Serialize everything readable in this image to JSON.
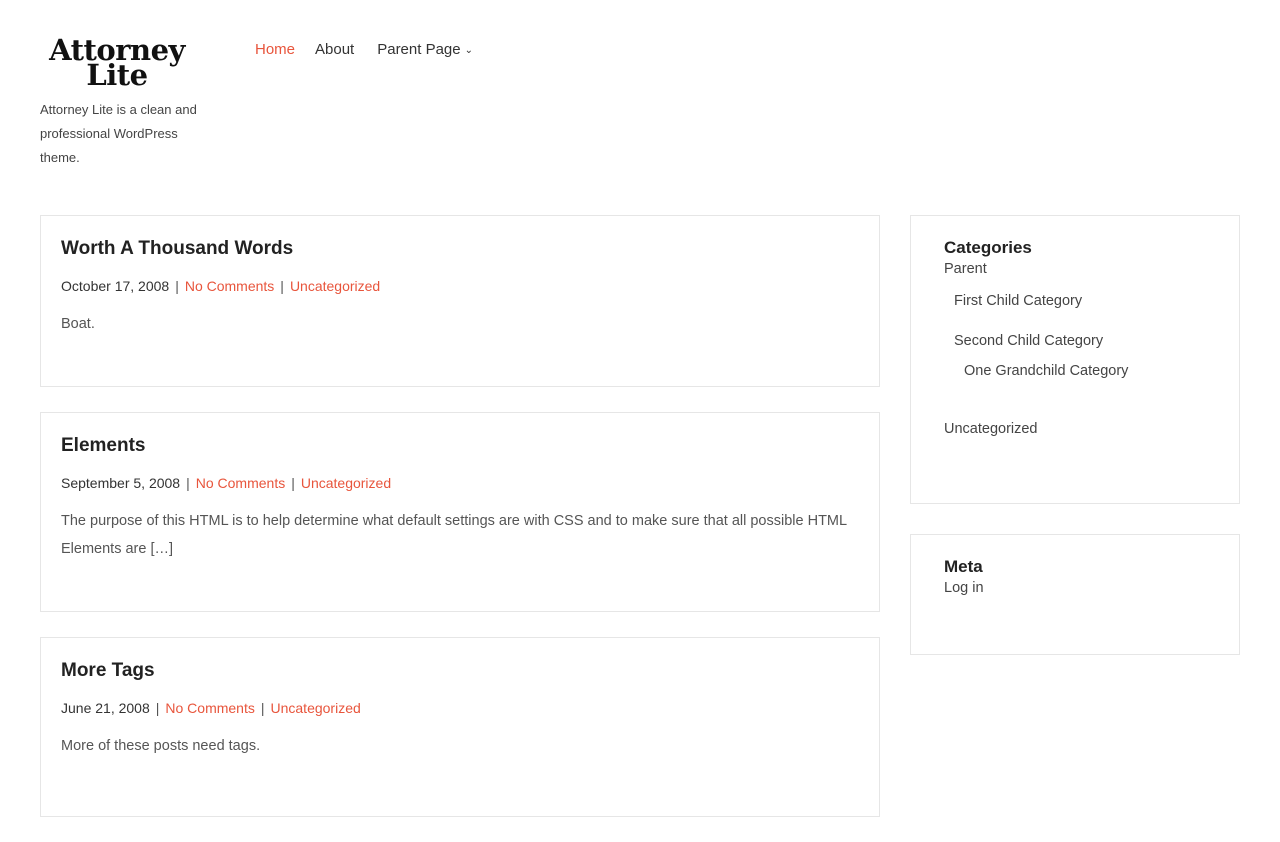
{
  "site": {
    "title_line1": "Attorney",
    "title_line2": "Lite",
    "tagline": "Attorney Lite is a clean and professional WordPress theme."
  },
  "nav": {
    "items": [
      {
        "label": "Home",
        "active": true
      },
      {
        "label": "About",
        "active": false
      }
    ],
    "parent_page": "Parent Page",
    "accent": "#e8553c"
  },
  "posts": [
    {
      "title": "Worth A Thousand Words",
      "date": "October 17, 2008",
      "separator": "|",
      "comments": "No Comments",
      "category": "Uncategorized",
      "excerpt": "Boat."
    },
    {
      "title": "Elements",
      "date": "September 5, 2008",
      "separator": "|",
      "comments": "No Comments",
      "category": "Uncategorized",
      "excerpt": "The purpose of this HTML is to help determine what default settings are with CSS and to make sure that all possible HTML Elements are […]"
    },
    {
      "title": "More Tags",
      "date": "June 21, 2008",
      "separator": "|",
      "comments": "No Comments",
      "category": "Uncategorized",
      "excerpt": "More of these posts need tags."
    }
  ],
  "sidebar": {
    "categories": {
      "title": "Categories",
      "parent": "Parent",
      "first_child": "First Child Category",
      "second_child": "Second Child Category",
      "grandchild": "One Grandchild Category",
      "uncategorized": "Uncategorized"
    },
    "meta": {
      "title": "Meta",
      "login": "Log in"
    }
  }
}
